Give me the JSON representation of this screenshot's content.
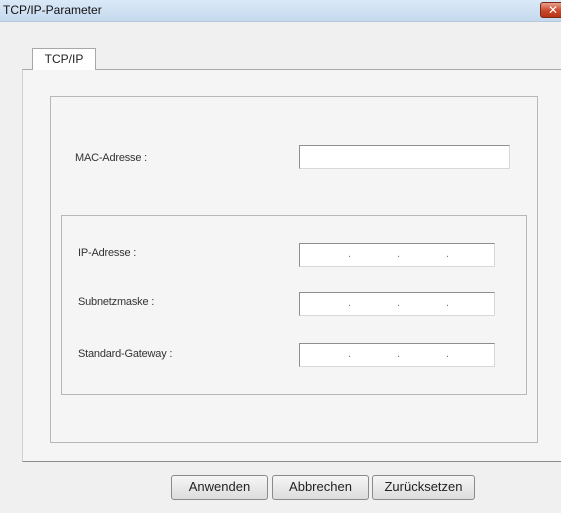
{
  "window": {
    "title": "TCP/IP-Parameter",
    "close_glyph": "✕"
  },
  "tabs": [
    {
      "label": "TCP/IP"
    }
  ],
  "form": {
    "mac_label": "MAC-Adresse :",
    "mac_value": "",
    "ip_label": "IP-Adresse :",
    "subnet_label": "Subnetzmaske :",
    "gateway_label": "Standard-Gateway :",
    "ip_separator": "."
  },
  "buttons": {
    "apply": "Anwenden",
    "cancel": "Abbrechen",
    "reset": "Zurücksetzen"
  },
  "icons": {
    "close": "close-icon"
  }
}
